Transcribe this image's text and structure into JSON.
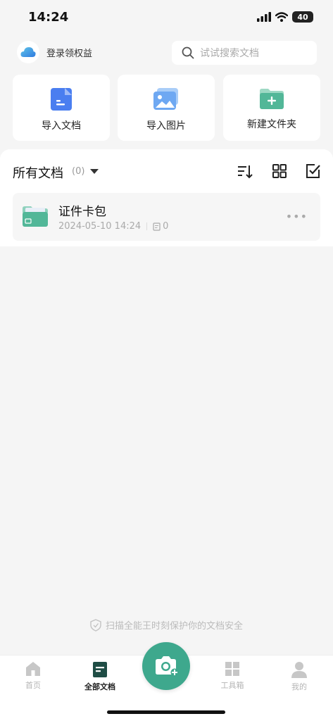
{
  "status_bar": {
    "time": "14:24",
    "battery": "40"
  },
  "header": {
    "login_label": "登录领权益",
    "search_placeholder": "试试搜索文档"
  },
  "quick_actions": [
    {
      "label": "导入文档",
      "icon": "document-icon"
    },
    {
      "label": "导入图片",
      "icon": "image-icon"
    },
    {
      "label": "新建文件夹",
      "icon": "new-folder-icon"
    }
  ],
  "section": {
    "title": "所有文档",
    "count": "(0)"
  },
  "documents": [
    {
      "name": "证件卡包",
      "date": "2024-05-10 14:24",
      "page_count": "0"
    }
  ],
  "security_note": "扫描全能王时刻保护你的文档安全",
  "tabs": [
    {
      "label": "首页",
      "icon": "home-icon",
      "active": false
    },
    {
      "label": "全部文档",
      "icon": "documents-icon",
      "active": true
    },
    {
      "label": "工具箱",
      "icon": "toolbox-icon",
      "active": false
    },
    {
      "label": "我的",
      "icon": "profile-icon",
      "active": false
    }
  ],
  "colors": {
    "accent": "#3ea88d",
    "doc_blue": "#4a7ef0",
    "image_blue": "#6ea8f2",
    "folder_green": "#52b798"
  }
}
